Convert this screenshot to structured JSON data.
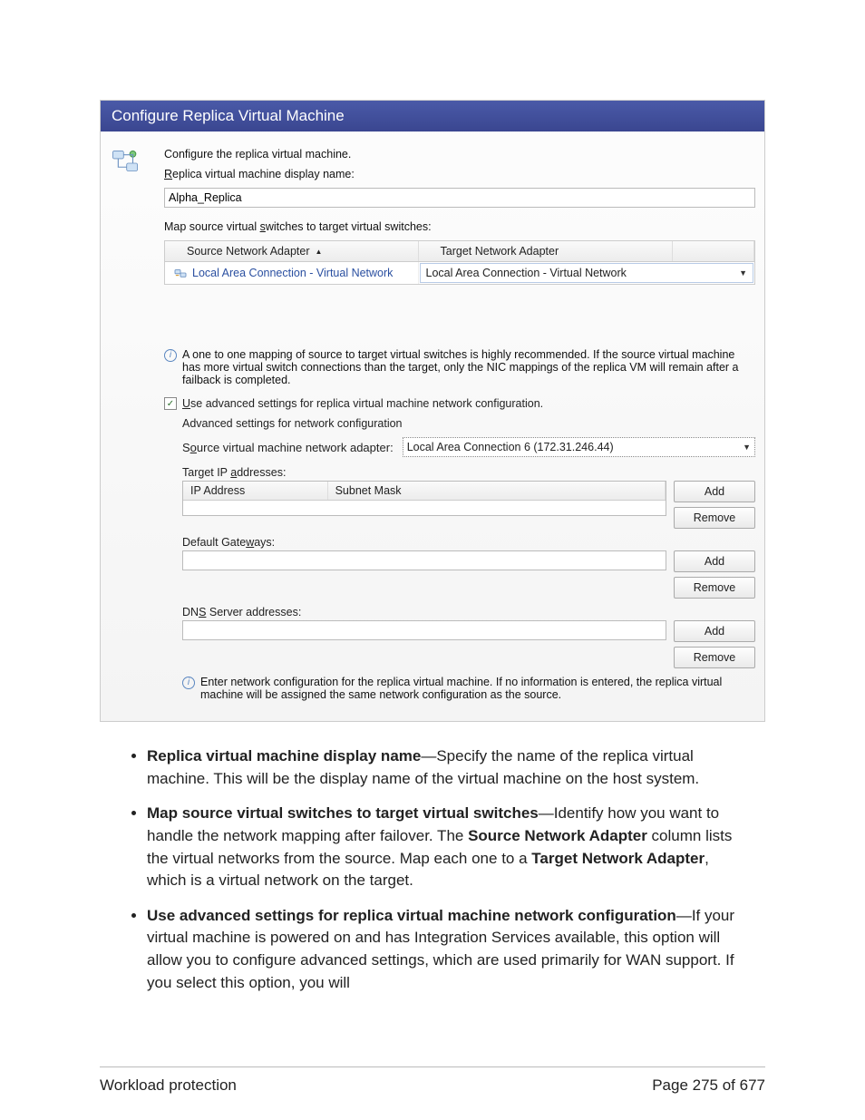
{
  "dialog": {
    "title": "Configure Replica Virtual Machine",
    "intro": "Configure the replica virtual machine.",
    "name_label_pre": "R",
    "name_label_post": "eplica virtual machine display name:",
    "name_value": "Alpha_Replica",
    "map_label_pre": "Map source virtual ",
    "map_label_u": "s",
    "map_label_post": "witches to target virtual switches:",
    "col_source": "Source Network Adapter",
    "col_target": "Target Network Adapter",
    "row_source": "Local Area Connection - Virtual Network",
    "row_target": "Local Area Connection - Virtual Network",
    "info1": "A one to one mapping of source to target virtual switches is highly recommended. If the source virtual machine has more virtual switch connections than the target, only the NIC mappings of the replica VM will remain after a failback is completed.",
    "advanced_chk_u": "U",
    "advanced_chk_post": "se advanced settings for replica virtual machine network configuration.",
    "adv_title": "Advanced settings for network configuration",
    "adapter_label_pre": "S",
    "adapter_label_u": "o",
    "adapter_label_post": "urce virtual machine network adapter:",
    "adapter_value": "Local Area Connection 6 (172.31.246.44)",
    "ip_label_pre": "Target IP ",
    "ip_label_u": "a",
    "ip_label_post": "ddresses:",
    "ip_col1": "IP Address",
    "ip_col2": "Subnet Mask",
    "gw_label_pre": "Default Gate",
    "gw_label_u": "w",
    "gw_label_post": "ays:",
    "dns_label_pre": "DN",
    "dns_label_u": "S",
    "dns_label_post": " Server addresses:",
    "btn_add": "Add",
    "btn_remove": "Remove",
    "info2": "Enter network configuration for the replica virtual machine. If no information is entered, the replica virtual machine will be assigned the same network configuration as the source."
  },
  "doc": {
    "b1_bold": "Replica virtual machine display name",
    "b1_rest": "—Specify the name of the replica virtual machine. This will be the display name of the virtual machine on the host system.",
    "b2_bold1": "Map source virtual switches to target virtual switches",
    "b2_mid1": "—Identify how you want to handle the network mapping after failover. The ",
    "b2_bold2": "Source Network Adapter",
    "b2_mid2": " column lists the virtual networks from the source. Map each one to a ",
    "b2_bold3": "Target Network Adapter",
    "b2_mid3": ", which is a virtual network on the target.",
    "b3_bold": "Use advanced settings for replica virtual machine network configuration",
    "b3_rest": "—If your virtual machine is powered on and has Integration Services available, this option will allow you to configure advanced settings, which are used primarily for WAN support. If you select this option, you will"
  },
  "footer": {
    "left": "Workload protection",
    "right": "Page 275 of 677"
  }
}
